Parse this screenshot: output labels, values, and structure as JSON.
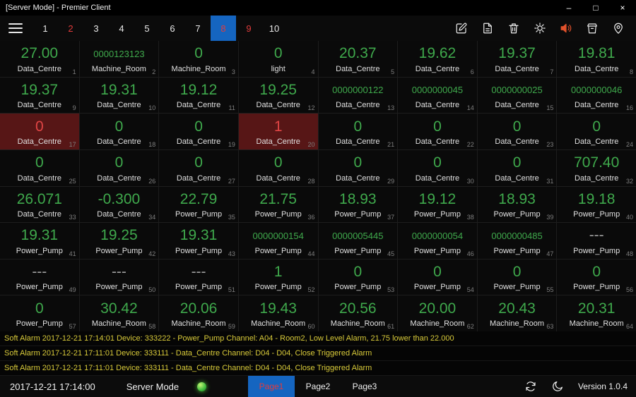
{
  "window": {
    "title": "[Server Mode] - Premier Client",
    "controls": {
      "minimize": "–",
      "maximize": "□",
      "close": "×"
    }
  },
  "toolbar": {
    "pages": [
      {
        "label": "1"
      },
      {
        "label": "2",
        "state": "alert"
      },
      {
        "label": "3"
      },
      {
        "label": "4"
      },
      {
        "label": "5"
      },
      {
        "label": "6"
      },
      {
        "label": "7"
      },
      {
        "label": "8",
        "state": "active"
      },
      {
        "label": "9",
        "state": "alert"
      },
      {
        "label": "10"
      }
    ],
    "icons": [
      "edit-icon",
      "report-icon",
      "trash-icon",
      "settings-icon",
      "speaker-icon",
      "bin-icon",
      "location-icon"
    ]
  },
  "grid": {
    "cells": [
      {
        "value": "27.00",
        "label": "Data_Centre",
        "index": "1"
      },
      {
        "value": "0000123123",
        "label": "Machine_Room",
        "index": "2",
        "small": true
      },
      {
        "value": "0",
        "label": "Machine_Room",
        "index": "3"
      },
      {
        "value": "0",
        "label": "light",
        "index": "4"
      },
      {
        "value": "20.37",
        "label": "Data_Centre",
        "index": "5"
      },
      {
        "value": "19.62",
        "label": "Data_Centre",
        "index": "6"
      },
      {
        "value": "19.37",
        "label": "Data_Centre",
        "index": "7"
      },
      {
        "value": "19.81",
        "label": "Data_Centre",
        "index": "8"
      },
      {
        "value": "19.37",
        "label": "Data_Centre",
        "index": "9"
      },
      {
        "value": "19.31",
        "label": "Data_Centre",
        "index": "10"
      },
      {
        "value": "19.12",
        "label": "Data_Centre",
        "index": "11"
      },
      {
        "value": "19.25",
        "label": "Data_Centre",
        "index": "12"
      },
      {
        "value": "0000000122",
        "label": "Data_Centre",
        "index": "13",
        "small": true
      },
      {
        "value": "0000000045",
        "label": "Data_Centre",
        "index": "14",
        "small": true
      },
      {
        "value": "0000000025",
        "label": "Data_Centre",
        "index": "15",
        "small": true
      },
      {
        "value": "0000000046",
        "label": "Data_Centre",
        "index": "16",
        "small": true
      },
      {
        "value": "0",
        "label": "Data_Centre",
        "index": "17",
        "state": "alarm"
      },
      {
        "value": "0",
        "label": "Data_Centre",
        "index": "18"
      },
      {
        "value": "0",
        "label": "Data_Centre",
        "index": "19"
      },
      {
        "value": "1",
        "label": "Data_Centre",
        "index": "20",
        "state": "alarm"
      },
      {
        "value": "0",
        "label": "Data_Centre",
        "index": "21"
      },
      {
        "value": "0",
        "label": "Data_Centre",
        "index": "22"
      },
      {
        "value": "0",
        "label": "Data_Centre",
        "index": "23"
      },
      {
        "value": "0",
        "label": "Data_Centre",
        "index": "24"
      },
      {
        "value": "0",
        "label": "Data_Centre",
        "index": "25"
      },
      {
        "value": "0",
        "label": "Data_Centre",
        "index": "26"
      },
      {
        "value": "0",
        "label": "Data_Centre",
        "index": "27"
      },
      {
        "value": "0",
        "label": "Data_Centre",
        "index": "28"
      },
      {
        "value": "0",
        "label": "Data_Centre",
        "index": "29"
      },
      {
        "value": "0",
        "label": "Data_Centre",
        "index": "30"
      },
      {
        "value": "0",
        "label": "Data_Centre",
        "index": "31"
      },
      {
        "value": "707.40",
        "label": "Data_Centre",
        "index": "32"
      },
      {
        "value": "26.071",
        "label": "Data_Centre",
        "index": "33"
      },
      {
        "value": "-0.300",
        "label": "Data_Centre",
        "index": "34"
      },
      {
        "value": "22.79",
        "label": "Power_Pump",
        "index": "35"
      },
      {
        "value": "21.75",
        "label": "Power_Pump",
        "index": "36"
      },
      {
        "value": "18.93",
        "label": "Power_Pump",
        "index": "37"
      },
      {
        "value": "19.12",
        "label": "Power_Pump",
        "index": "38"
      },
      {
        "value": "18.93",
        "label": "Power_Pump",
        "index": "39"
      },
      {
        "value": "19.18",
        "label": "Power_Pump",
        "index": "40"
      },
      {
        "value": "19.31",
        "label": "Power_Pump",
        "index": "41"
      },
      {
        "value": "19.25",
        "label": "Power_Pump",
        "index": "42"
      },
      {
        "value": "19.31",
        "label": "Power_Pump",
        "index": "43"
      },
      {
        "value": "0000000154",
        "label": "Power_Pump",
        "index": "44",
        "small": true
      },
      {
        "value": "0000005445",
        "label": "Power_Pump",
        "index": "45",
        "small": true
      },
      {
        "value": "0000000054",
        "label": "Power_Pump",
        "index": "46",
        "small": true
      },
      {
        "value": "0000000485",
        "label": "Power_Pump",
        "index": "47",
        "small": true
      },
      {
        "value": "---",
        "label": "Power_Pump",
        "index": "48",
        "state": "nodata"
      },
      {
        "value": "---",
        "label": "Power_Pump",
        "index": "49",
        "state": "nodata"
      },
      {
        "value": "---",
        "label": "Power_Pump",
        "index": "50",
        "state": "nodata"
      },
      {
        "value": "---",
        "label": "Power_Pump",
        "index": "51",
        "state": "nodata"
      },
      {
        "value": "1",
        "label": "Power_Pump",
        "index": "52"
      },
      {
        "value": "0",
        "label": "Power_Pump",
        "index": "53"
      },
      {
        "value": "0",
        "label": "Power_Pump",
        "index": "54"
      },
      {
        "value": "0",
        "label": "Power_Pump",
        "index": "55"
      },
      {
        "value": "0",
        "label": "Power_Pump",
        "index": "56"
      },
      {
        "value": "0",
        "label": "Power_Pump",
        "index": "57"
      },
      {
        "value": "30.42",
        "label": "Machine_Room",
        "index": "58"
      },
      {
        "value": "20.06",
        "label": "Machine_Room",
        "index": "59"
      },
      {
        "value": "19.43",
        "label": "Machine_Room",
        "index": "60"
      },
      {
        "value": "20.56",
        "label": "Machine_Room",
        "index": "61"
      },
      {
        "value": "20.00",
        "label": "Machine_Room",
        "index": "62"
      },
      {
        "value": "20.43",
        "label": "Machine_Room",
        "index": "63"
      },
      {
        "value": "20.31",
        "label": "Machine_Room",
        "index": "64"
      }
    ]
  },
  "alarms": [
    "Soft Alarm 2017-12-21 17:14:01 Device: 333222 - Power_Pump Channel: A04 - Room2, Low Level Alarm, 21.75 lower than 22.000",
    "Soft Alarm 2017-12-21 17:11:01 Device: 333111 - Data_Centre Channel: D04 - D04, Close Triggered Alarm",
    "Soft Alarm 2017-12-21 17:11:01 Device: 333111 - Data_Centre Channel: D04 - D04, Close Triggered Alarm"
  ],
  "statusbar": {
    "datetime": "2017-12-21 17:14:00",
    "mode_label": "Server Mode",
    "tabs": [
      {
        "label": "Page1",
        "active": true
      },
      {
        "label": "Page2",
        "active": false
      },
      {
        "label": "Page3",
        "active": false
      }
    ],
    "icons": [
      "sync-icon",
      "night-mode-icon"
    ],
    "version": "Version 1.0.4"
  },
  "colors": {
    "value_green": "#3fa94c",
    "alarm_red": "#e04545",
    "alarm_cell_bg": "#571616",
    "alarm_text_yellow": "#d9cb3a",
    "accent_blue": "#1565c0",
    "status_dot_green": "#3db93d"
  }
}
